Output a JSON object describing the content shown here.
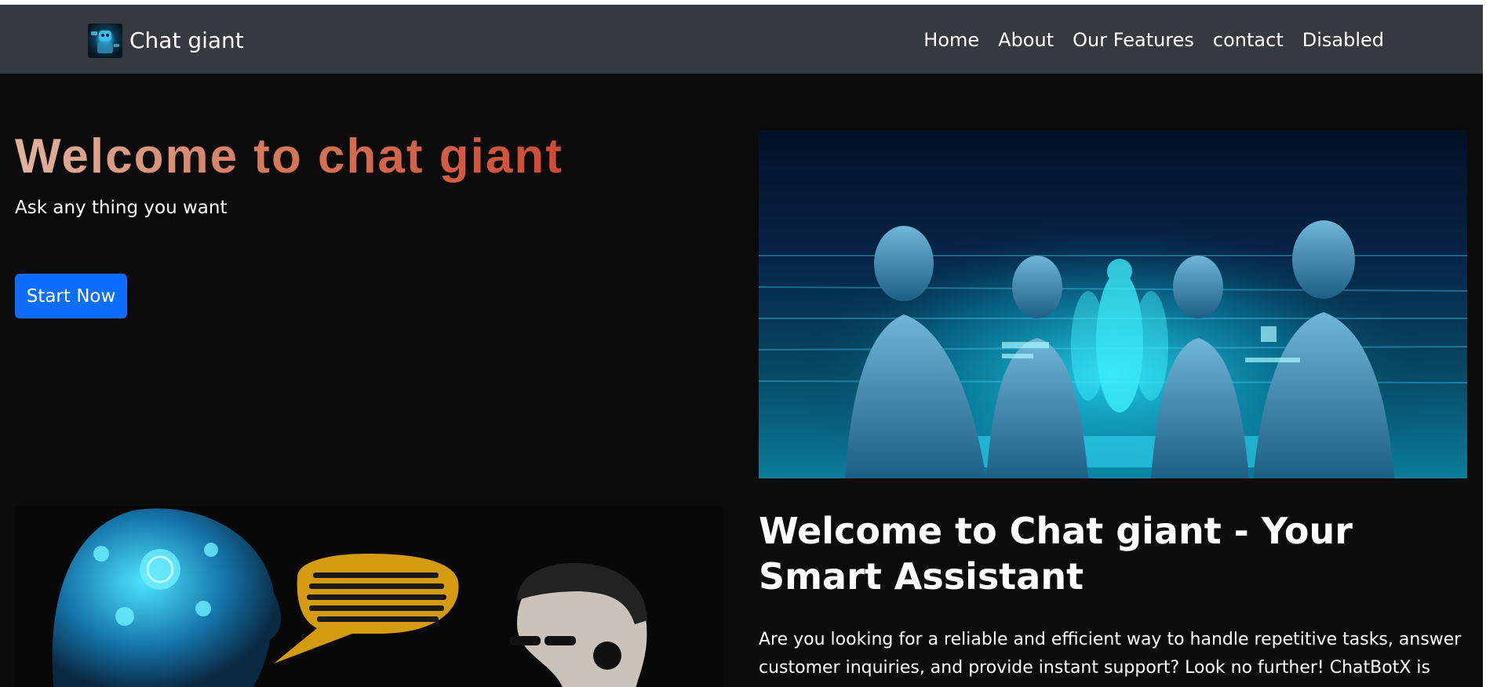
{
  "navbar": {
    "brand": "Chat giant",
    "links": [
      {
        "label": "Home"
      },
      {
        "label": "About"
      },
      {
        "label": "Our Features"
      },
      {
        "label": "contact"
      },
      {
        "label": "Disabled"
      }
    ]
  },
  "hero": {
    "title": "Welcome to chat giant",
    "subtitle": "Ask any thing you want",
    "cta_label": "Start Now"
  },
  "section": {
    "title": "Welcome to Chat giant - Your Smart Assistant",
    "body": "Are you looking for a reliable and efficient way to handle repetitive tasks, answer customer inquiries, and provide instant support? Look no further! ChatBotX is here to"
  },
  "colors": {
    "navbar_bg": "#343a40",
    "page_bg": "#0b0b0b",
    "button_bg": "#0d6efd",
    "title_gradient_start": "#e0b3a0",
    "title_gradient_end": "#cf4a33"
  }
}
